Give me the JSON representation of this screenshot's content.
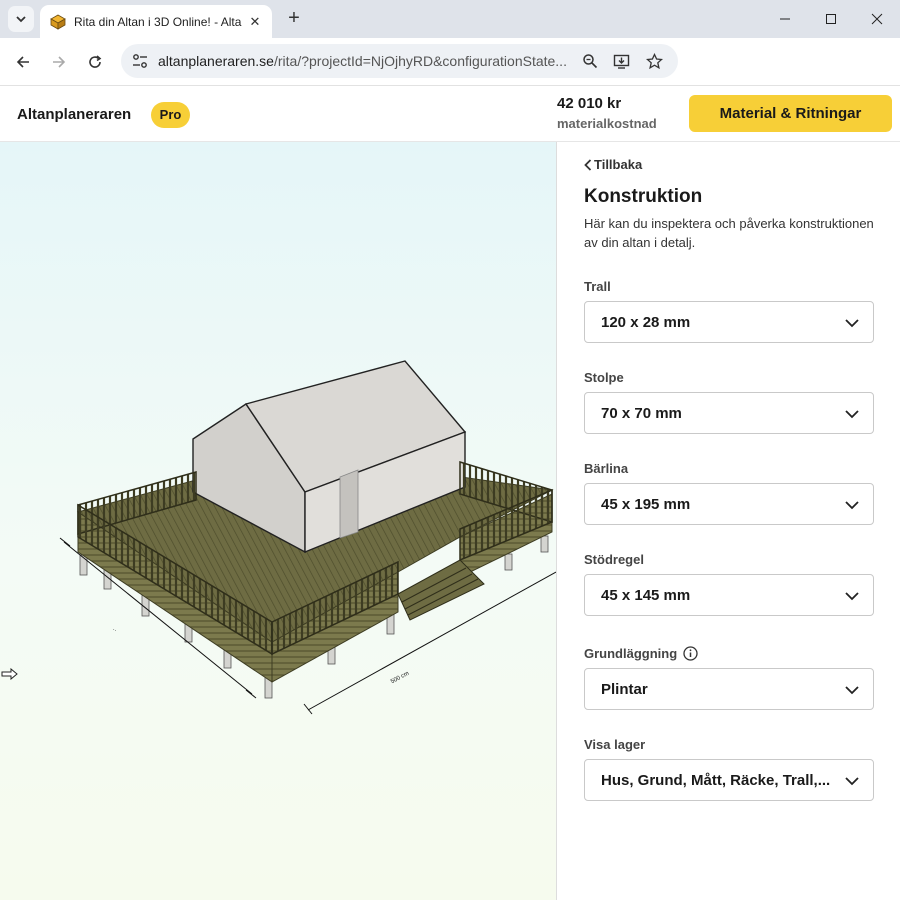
{
  "browser": {
    "tab_title": "Rita din Altan i 3D Online! - Alta",
    "url_host": "altanplaneraren.se",
    "url_path": "/rita/?projectId=NjOjhyRD&configurationState...",
    "icons": [
      "tab-search-icon",
      "favicon-icon",
      "close-icon",
      "plus-icon",
      "minimize-icon",
      "maximize-icon",
      "window-close-icon",
      "back-icon",
      "forward-icon",
      "reload-icon",
      "site-settings-icon",
      "zoom-icon",
      "install-app-icon",
      "star-icon"
    ]
  },
  "header": {
    "brand": "Altanplaneraren",
    "badge": "Pro",
    "price": "42 010 kr",
    "price_caption": "materialkostnad",
    "cta_label": "Material & Ritningar",
    "accent": "#f7cf37"
  },
  "panel": {
    "back_label": "Tillbaka",
    "title": "Konstruktion",
    "description": "Här kan du inspektera och påverka konstruktionen av din altan i detalj.",
    "fields": [
      {
        "label": "Trall",
        "value": "120 x 28 mm"
      },
      {
        "label": "Stolpe",
        "value": "70 x 70 mm"
      },
      {
        "label": "Bärlina",
        "value": "45 x 195 mm"
      },
      {
        "label": "Stödregel",
        "value": "45 x 145 mm"
      },
      {
        "label": "Grundläggning",
        "value": "Plintar"
      },
      {
        "label": "Visa lager",
        "value": "Hus, Grund, Mått, Räcke, Trall,..."
      }
    ]
  },
  "scene": {
    "dimension_labels": [
      "500 cm"
    ],
    "deck_color": "#6b6a40",
    "house_color": "#d8d6d2"
  }
}
